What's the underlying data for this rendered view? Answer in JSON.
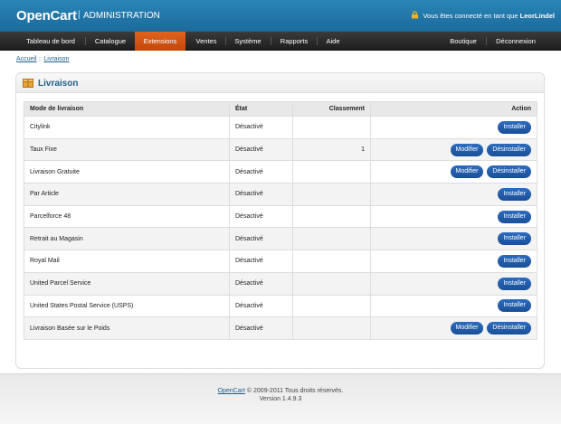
{
  "header": {
    "logo_open": "Open",
    "logo_cart": "Cart",
    "separator": "|",
    "admin_label": "ADMINISTRATION",
    "user_prefix": "Vous êtes connecté en tant que",
    "username": "LeorLindel"
  },
  "nav": {
    "left": [
      "Tableau de bord",
      "Catalogue",
      "Extensions",
      "Ventes",
      "Système",
      "Rapports",
      "Aide"
    ],
    "active": "Extensions",
    "right": [
      "Boutique",
      "Déconnexion"
    ]
  },
  "breadcrumb": {
    "home": "Accueil",
    "sep": "::",
    "current": "Livraison"
  },
  "box": {
    "title": "Livraison"
  },
  "table": {
    "headers": [
      "Mode de livraison",
      "État",
      "Classement",
      "Action"
    ],
    "rows": [
      {
        "name": "Citylink",
        "status": "Désactivé",
        "rank": "",
        "actions": [
          "Installer"
        ]
      },
      {
        "name": "Taux Fixe",
        "status": "Désactivé",
        "rank": "1",
        "actions": [
          "Modifier",
          "Désinstaller"
        ]
      },
      {
        "name": "Livraison Gratuite",
        "status": "Désactivé",
        "rank": "",
        "actions": [
          "Modifier",
          "Désinstaller"
        ]
      },
      {
        "name": "Par Article",
        "status": "Désactivé",
        "rank": "",
        "actions": [
          "Installer"
        ]
      },
      {
        "name": "Parcelforce 48",
        "status": "Désactivé",
        "rank": "",
        "actions": [
          "Installer"
        ]
      },
      {
        "name": "Retrait au Magasin",
        "status": "Désactivé",
        "rank": "",
        "actions": [
          "Installer"
        ]
      },
      {
        "name": "Royal Mail",
        "status": "Désactivé",
        "rank": "",
        "actions": [
          "Installer"
        ]
      },
      {
        "name": "United Parcel Service",
        "status": "Désactivé",
        "rank": "",
        "actions": [
          "Installer"
        ]
      },
      {
        "name": "United States Postal Service (USPS)",
        "status": "Désactivé",
        "rank": "",
        "actions": [
          "Installer"
        ]
      },
      {
        "name": "Livraison Basée sur le Poids",
        "status": "Désactivé",
        "rank": "",
        "actions": [
          "Modifier",
          "Désinstaller"
        ]
      }
    ]
  },
  "footer": {
    "link": "OpenCart",
    "copyright": "© 2009-2011 Tous droits réservés.",
    "version": "Version 1.4.9.3"
  },
  "colors": {
    "header_blue": "#1f78ad",
    "nav_dark": "#2b2b2b",
    "nav_active_orange": "#d9561a",
    "button_blue": "#1f5aa8",
    "title_blue": "#1f5f8b"
  },
  "icons": {
    "lock": "lock-icon",
    "box": "package-icon"
  }
}
